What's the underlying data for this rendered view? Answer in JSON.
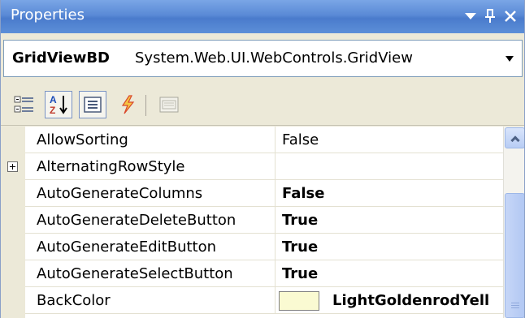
{
  "window": {
    "title": "Properties"
  },
  "object_selector": {
    "name": "GridViewBD",
    "type": "System.Web.UI.WebControls.GridView"
  },
  "toolbar": {
    "buttons": [
      {
        "name": "categorized-icon",
        "pressed": false
      },
      {
        "name": "alphabetical-icon",
        "pressed": true
      },
      {
        "name": "properties-icon",
        "pressed": true
      },
      {
        "name": "events-icon",
        "pressed": false
      },
      {
        "name": "property-pages-icon",
        "pressed": false,
        "disabled": true
      }
    ]
  },
  "grid": {
    "rows": [
      {
        "name": "AllowSorting",
        "value": "False",
        "bold": false,
        "expandable": false
      },
      {
        "name": "AlternatingRowStyle",
        "value": "",
        "bold": false,
        "expandable": true
      },
      {
        "name": "AutoGenerateColumns",
        "value": "False",
        "bold": true,
        "expandable": false
      },
      {
        "name": "AutoGenerateDeleteButton",
        "value": "True",
        "bold": true,
        "expandable": false
      },
      {
        "name": "AutoGenerateEditButton",
        "value": "True",
        "bold": true,
        "expandable": false
      },
      {
        "name": "AutoGenerateSelectButton",
        "value": "True",
        "bold": true,
        "expandable": false
      },
      {
        "name": "BackColor",
        "value": "LightGoldenrodYell",
        "bold": true,
        "expandable": false,
        "swatch": "#fafad2"
      }
    ]
  },
  "colors": {
    "title_bar": "#5a8ad6",
    "panel": "#ece9d8",
    "scrollbar": "#b8cdf4"
  }
}
